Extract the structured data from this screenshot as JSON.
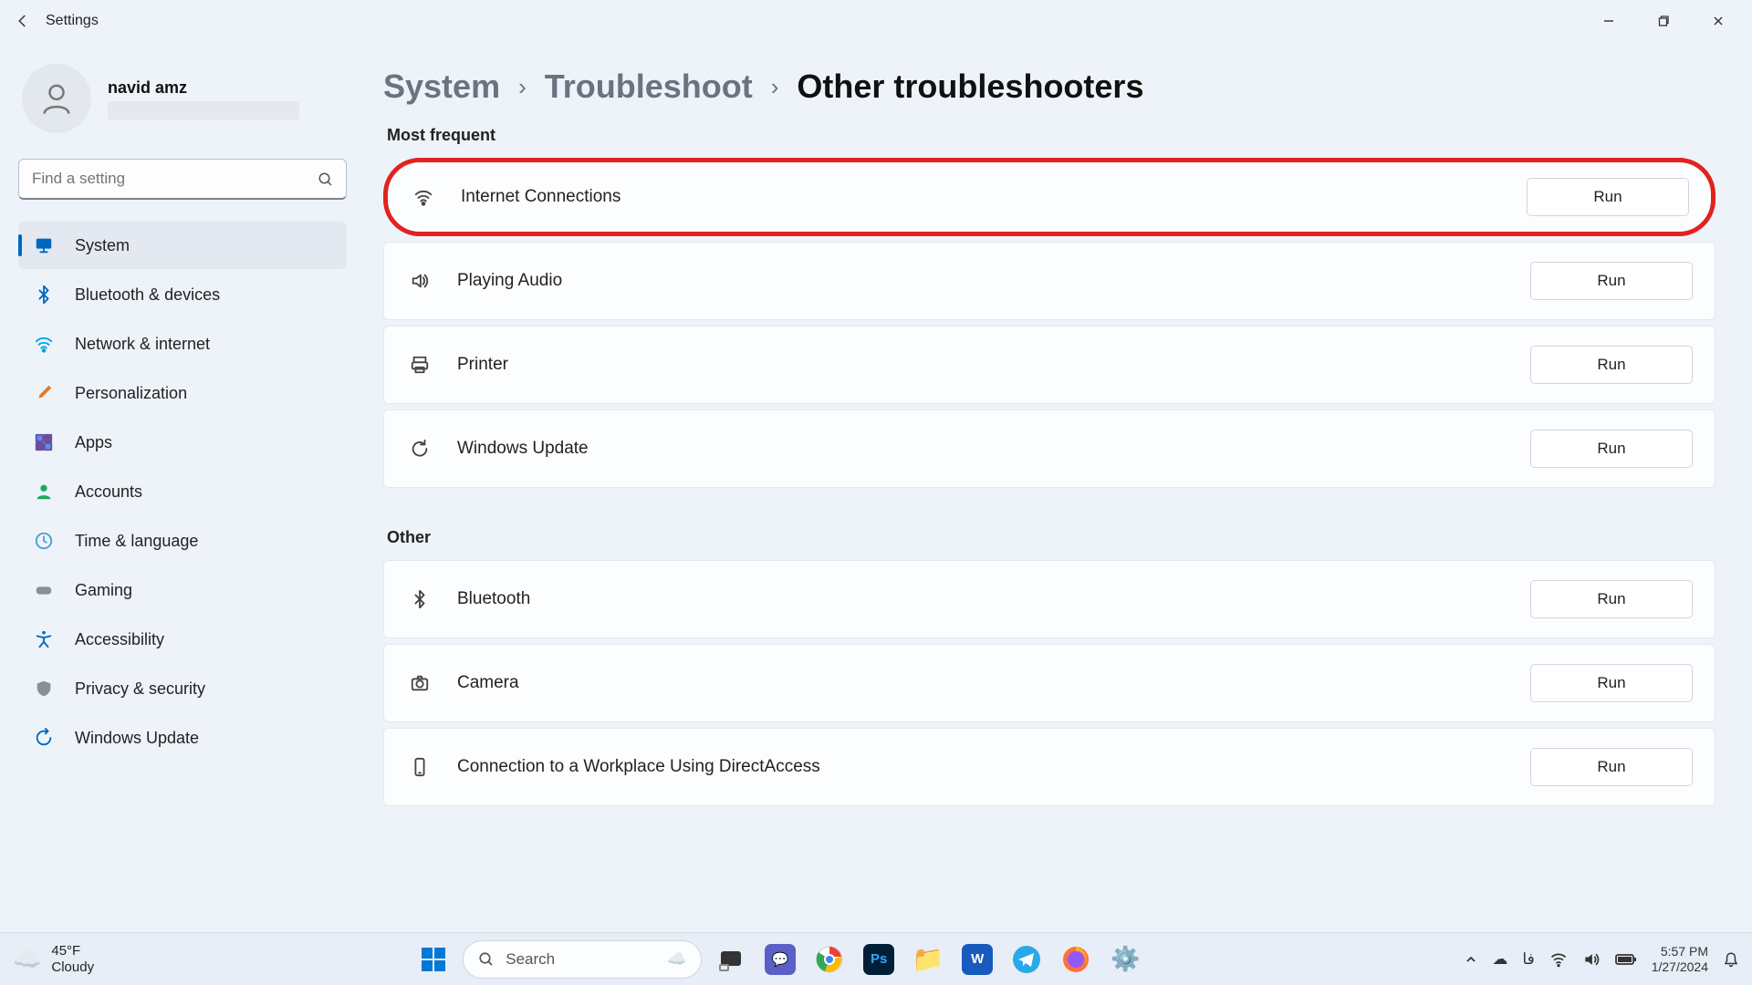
{
  "app_title": "Settings",
  "user": {
    "name": "navid amz"
  },
  "search": {
    "placeholder": "Find a setting"
  },
  "nav": {
    "items": [
      {
        "label": "System",
        "icon": "monitor",
        "color": "#0067c0",
        "active": true
      },
      {
        "label": "Bluetooth & devices",
        "icon": "bluetooth",
        "color": "#0067c0",
        "active": false
      },
      {
        "label": "Network & internet",
        "icon": "wifi",
        "color": "#00a2ed",
        "active": false
      },
      {
        "label": "Personalization",
        "icon": "brush",
        "color": "#e07b2e",
        "active": false
      },
      {
        "label": "Apps",
        "icon": "apps",
        "color": "#6b4ea0",
        "active": false
      },
      {
        "label": "Accounts",
        "icon": "person",
        "color": "#1aab5a",
        "active": false
      },
      {
        "label": "Time & language",
        "icon": "clock",
        "color": "#4a9ed6",
        "active": false
      },
      {
        "label": "Gaming",
        "icon": "gamepad",
        "color": "#8a8f96",
        "active": false
      },
      {
        "label": "Accessibility",
        "icon": "accessibility",
        "color": "#0067c0",
        "active": false
      },
      {
        "label": "Privacy & security",
        "icon": "shield",
        "color": "#8a8f96",
        "active": false
      },
      {
        "label": "Windows Update",
        "icon": "update",
        "color": "#0067c0",
        "active": false
      }
    ]
  },
  "breadcrumb": {
    "items": [
      {
        "label": "System",
        "current": false
      },
      {
        "label": "Troubleshoot",
        "current": false
      },
      {
        "label": "Other troubleshooters",
        "current": true
      }
    ],
    "separator": "›"
  },
  "sections": {
    "most_frequent": {
      "title": "Most frequent",
      "items": [
        {
          "label": "Internet Connections",
          "icon": "wifi",
          "highlighted": true,
          "run": "Run"
        },
        {
          "label": "Playing Audio",
          "icon": "speaker",
          "highlighted": false,
          "run": "Run"
        },
        {
          "label": "Printer",
          "icon": "printer",
          "highlighted": false,
          "run": "Run"
        },
        {
          "label": "Windows Update",
          "icon": "refresh",
          "highlighted": false,
          "run": "Run"
        }
      ]
    },
    "other": {
      "title": "Other",
      "items": [
        {
          "label": "Bluetooth",
          "icon": "bluetooth",
          "run": "Run"
        },
        {
          "label": "Camera",
          "icon": "camera",
          "run": "Run"
        },
        {
          "label": "Connection to a Workplace Using DirectAccess",
          "icon": "phone",
          "run": "Run"
        }
      ]
    }
  },
  "taskbar": {
    "weather": {
      "temp": "45°F",
      "condition": "Cloudy"
    },
    "search_placeholder": "Search",
    "tray": {
      "lang": "فا",
      "time": "5:57 PM",
      "date": "1/27/2024"
    }
  }
}
